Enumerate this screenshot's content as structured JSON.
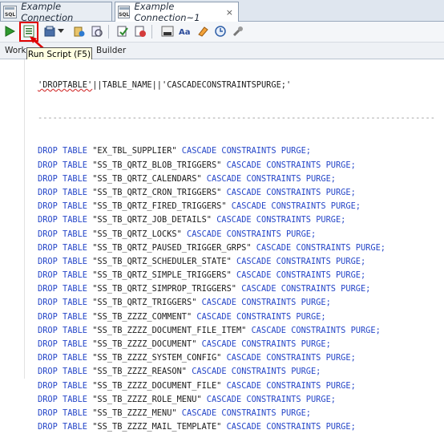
{
  "tabs": [
    {
      "label": "Example Connection"
    },
    {
      "label": "Example Connection~1"
    }
  ],
  "tab_icon_text": "SQL",
  "tab_close_glyph": "×",
  "toolbar": {
    "run_script_tooltip": "Run Script (F5)",
    "icons": [
      "run-statement-icon",
      "run-script-icon",
      "commit-icon",
      "dropdown-icon",
      "rollback-icon",
      "sql-history-icon",
      "explain-plan-icon",
      "autotrace-icon",
      "uppercase-icon",
      "text-format-icon",
      "clear-icon",
      "sql-tuning-icon",
      "settings-icon"
    ]
  },
  "subtabs": {
    "worksheet": "Work",
    "builder": "Builder"
  },
  "editor": {
    "header": {
      "str1": "'DROPTABLE'",
      "mid": "||TABLE_NAME||",
      "str2": "'CASCADECONSTRAINTSPURGE;'"
    },
    "separator": "--------------------------------------------------------------------------------",
    "drop_keyword": "DROP TABLE",
    "cascade_keyword": "CASCADE CONSTRAINTS PURGE;",
    "tables": [
      "\"EX_TBL_SUPPLIER\"",
      "\"SS_TB_QRTZ_BLOB_TRIGGERS\"",
      "\"SS_TB_QRTZ_CALENDARS\"",
      "\"SS_TB_QRTZ_CRON_TRIGGERS\"",
      "\"SS_TB_QRTZ_FIRED_TRIGGERS\"",
      "\"SS_TB_QRTZ_JOB_DETAILS\"",
      "\"SS_TB_QRTZ_LOCKS\"",
      "\"SS_TB_QRTZ_PAUSED_TRIGGER_GRPS\"",
      "\"SS_TB_QRTZ_SCHEDULER_STATE\"",
      "\"SS_TB_QRTZ_SIMPLE_TRIGGERS\"",
      "\"SS_TB_QRTZ_SIMPROP_TRIGGERS\"",
      "\"SS_TB_QRTZ_TRIGGERS\"",
      "\"SS_TB_ZZZZ_COMMENT\"",
      "\"SS_TB_ZZZZ_DOCUMENT_FILE_ITEM\"",
      "\"SS_TB_ZZZZ_DOCUMENT\"",
      "\"SS_TB_ZZZZ_SYSTEM_CONFIG\"",
      "\"SS_TB_ZZZZ_REASON\"",
      "\"SS_TB_ZZZZ_DOCUMENT_FILE\"",
      "\"SS_TB_ZZZZ_ROLE_MENU\"",
      "\"SS_TB_ZZZZ_MENU\"",
      "\"SS_TB_ZZZZ_MAIL_TEMPLATE\""
    ]
  }
}
